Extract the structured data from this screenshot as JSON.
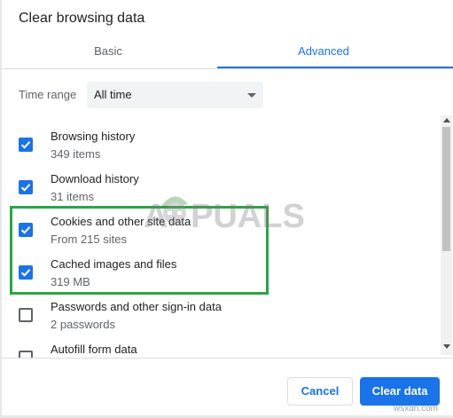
{
  "dialog": {
    "title": "Clear browsing data"
  },
  "tabs": [
    {
      "label": "Basic",
      "active": false
    },
    {
      "label": "Advanced",
      "active": true
    }
  ],
  "time_range": {
    "label": "Time range",
    "value": "All time"
  },
  "items": [
    {
      "title": "Browsing history",
      "subtitle": "349 items",
      "checked": true
    },
    {
      "title": "Download history",
      "subtitle": "31 items",
      "checked": true
    },
    {
      "title": "Cookies and other site data",
      "subtitle": "From 215 sites",
      "checked": true
    },
    {
      "title": "Cached images and files",
      "subtitle": "319 MB",
      "checked": true
    },
    {
      "title": "Passwords and other sign-in data",
      "subtitle": "2 passwords",
      "checked": false
    },
    {
      "title": "Autofill form data",
      "subtitle": "",
      "checked": false
    }
  ],
  "buttons": {
    "cancel": "Cancel",
    "clear": "Clear data"
  },
  "watermark": "APPUALS",
  "credit": "wsxdn.com",
  "colors": {
    "accent": "#1a73e8",
    "highlight": "#28a745"
  }
}
